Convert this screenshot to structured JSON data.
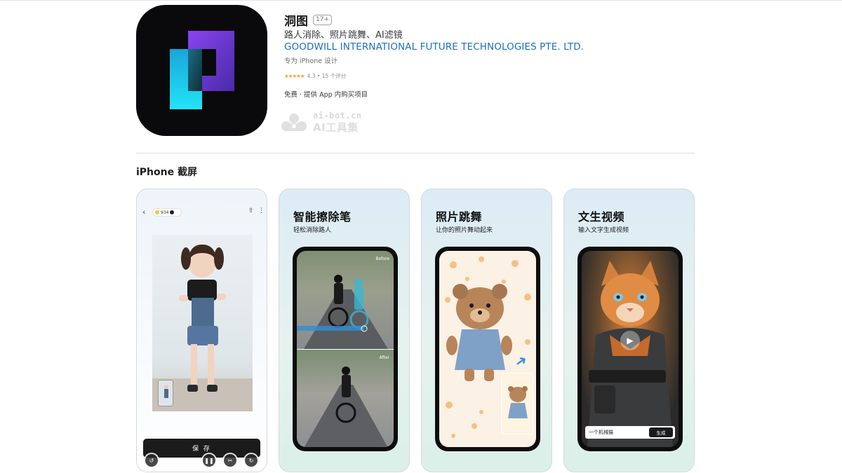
{
  "app": {
    "title": "洞图",
    "age_rating": "17+",
    "subtitle": "路人消除、照片跳舞、AI滤镜",
    "developer": "GOODWILL INTERNATIONAL FUTURE TECHNOLOGIES PTE. LTD.",
    "designed_for": "专为 iPhone 设计",
    "stars": "★★★★★",
    "rating_text": "4.3 • 15 个评分",
    "rating_value": 4.3,
    "price_text": "免费 · 提供 App 内购买项目"
  },
  "watermark": {
    "url": "ai-bot.cn",
    "name": "AI工具集"
  },
  "section": {
    "title": "iPhone 截屏"
  },
  "shots": [
    {
      "back_icon": "‹",
      "coin_count": "934",
      "share_icon": "⇧",
      "more_icon": "⋮",
      "save_label": "保 存",
      "tools": [
        "↺",
        "❚❚",
        "✂",
        "↻"
      ]
    },
    {
      "heading": "智能擦除笔",
      "caption": "轻松消除路人",
      "before_label": "Before",
      "after_label": "After"
    },
    {
      "heading": "照片跳舞",
      "caption": "让你的照片舞动起来"
    },
    {
      "heading": "文生视频",
      "caption": "输入文字生成视频",
      "prompt_text": "一个机械猫",
      "generate_label": "生成"
    }
  ],
  "colors": {
    "developer_link": "#1a6fc7",
    "star": "#f2a33a",
    "icon_bg": "#0a0a0c",
    "icon_purple": "#7b3fe4",
    "icon_cyan": "#1fd3f0"
  },
  "icons": {
    "app_icon": "dongtu-logo-icon",
    "watermark_logo": "cloud-logo-icon"
  }
}
